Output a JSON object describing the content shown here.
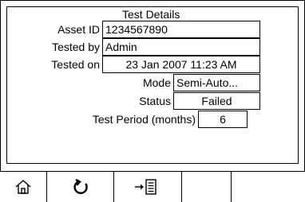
{
  "panel": {
    "title": "Test Details"
  },
  "fields": {
    "asset_id": {
      "label": "Asset ID",
      "value": "1234567890"
    },
    "tested_by": {
      "label": "Tested by",
      "value": "Admin"
    },
    "tested_on": {
      "label": "Tested on",
      "value": "23 Jan 2007 11:23 AM"
    },
    "mode": {
      "label": "Mode",
      "value": "Semi-Auto..."
    },
    "status": {
      "label": "Status",
      "value": "Failed"
    },
    "test_period": {
      "label": "Test Period (months)",
      "value": "6"
    }
  },
  "toolbar": {
    "buttons": [
      {
        "icon": "home-icon"
      },
      {
        "icon": "refresh-icon"
      },
      {
        "icon": "export-to-list-icon"
      }
    ]
  }
}
